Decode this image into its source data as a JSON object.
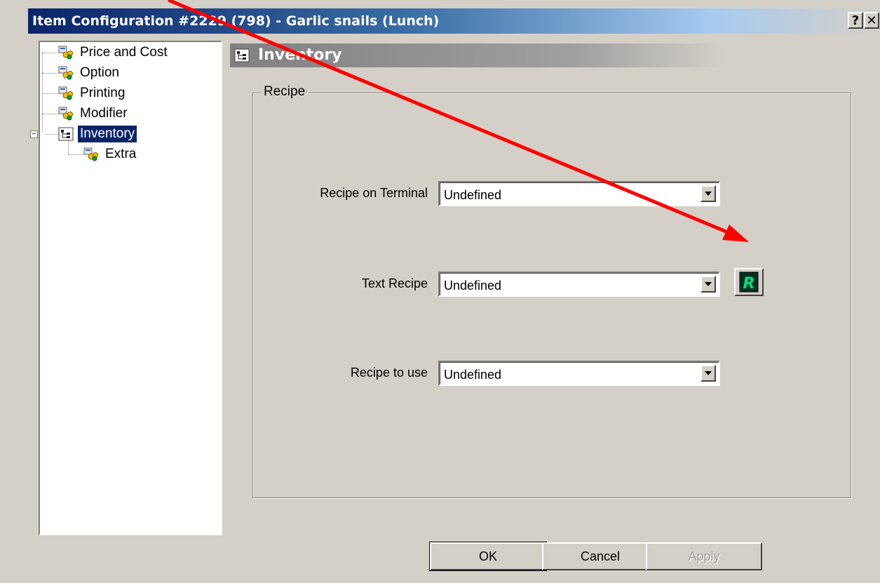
{
  "window": {
    "title": "Item Configuration #2229 (798) - Garlic snails (Lunch)",
    "help_button": "?",
    "close_button": "✕"
  },
  "tree": {
    "items": [
      {
        "label": "Price and Cost",
        "icon": "gear-group-icon"
      },
      {
        "label": "Option",
        "icon": "gear-group-icon"
      },
      {
        "label": "Printing",
        "icon": "gear-group-icon"
      },
      {
        "label": "Modifier",
        "icon": "gear-group-icon"
      },
      {
        "label": "Inventory",
        "icon": "hierarchy-icon",
        "selected": true,
        "expanded": true
      },
      {
        "label": "Extra",
        "icon": "gear-group-icon"
      }
    ],
    "expander_symbol": "−"
  },
  "page": {
    "header": "Inventory",
    "group_label": "Recipe",
    "fields": [
      {
        "label": "Recipe on Terminal",
        "value": "Undefined"
      },
      {
        "label": "Text Recipe",
        "value": "Undefined"
      },
      {
        "label": "Recipe to use",
        "value": "Undefined"
      }
    ]
  },
  "buttons": {
    "ok": "OK",
    "cancel": "Cancel",
    "apply": "Apply"
  },
  "colors": {
    "title_bar": "#0a246a",
    "selection": "#0a246a",
    "annotation_arrow": "#ff0000",
    "r_button_icon": "#00c060"
  }
}
